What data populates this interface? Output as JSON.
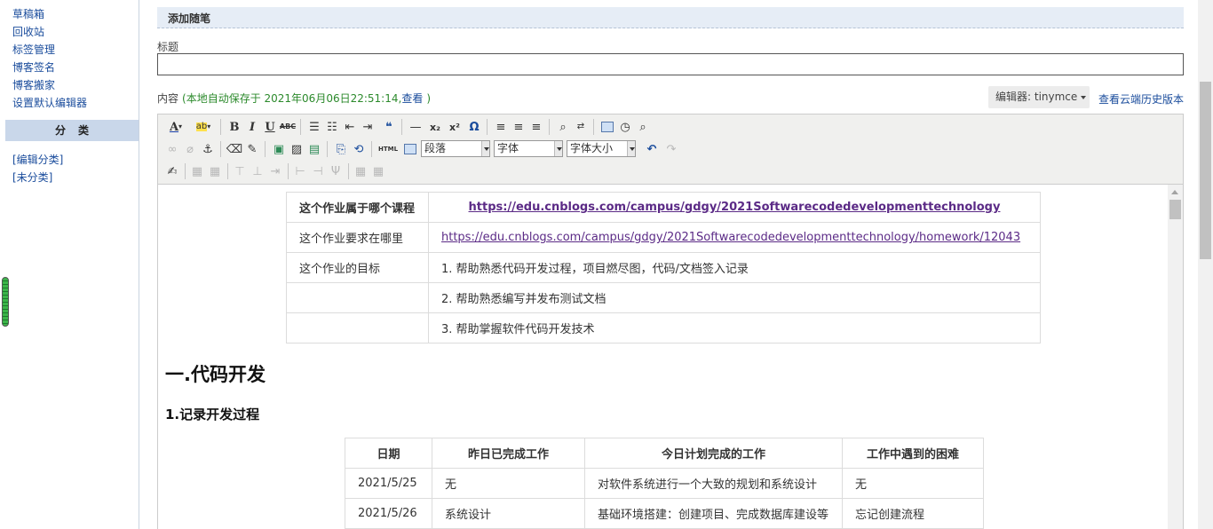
{
  "sidebar": {
    "links": [
      "草稿箱",
      "回收站",
      "标签管理",
      "博客签名",
      "博客搬家",
      "设置默认编辑器"
    ],
    "category_header": "分类",
    "category_links": [
      "[编辑分类]",
      "[未分类]"
    ]
  },
  "section": {
    "title": "添加随笔"
  },
  "title_field": {
    "label": "标题",
    "value": ""
  },
  "content": {
    "label": "内容",
    "autosave_text": "(本地自动保存于 2021年06月06日22:51:14,",
    "view_link": "查看",
    "close_paren": ")"
  },
  "editor_select": {
    "label": "编辑器: tinymce"
  },
  "history_link": "查看云端历史版本",
  "toolbar": {
    "format_select": "段落",
    "font_select": "字体",
    "size_select": "字体大小",
    "html_label": "HTML"
  },
  "info_table": {
    "rows": [
      {
        "key": "这个作业属于哪个课程",
        "value": "https://edu.cnblogs.com/campus/gdgy/2021Softwarecodedevelopmenttechnology"
      },
      {
        "key": "这个作业要求在哪里",
        "value": "https://edu.cnblogs.com/campus/gdgy/2021Softwarecodedevelopmenttechnology/homework/12043"
      },
      {
        "key": "这个作业的目标",
        "value": "1. 帮助熟悉代码开发过程，项目燃尽图，代码/文档签入记录"
      },
      {
        "key": "",
        "value": "2. 帮助熟悉编写并发布测试文档"
      },
      {
        "key": "",
        "value": "3. 帮助掌握软件代码开发技术"
      }
    ]
  },
  "heading1": "一.代码开发",
  "heading2": "1.记录开发过程",
  "log_table": {
    "headers": [
      "日期",
      "昨日已完成工作",
      "今日计划完成的工作",
      "工作中遇到的困难"
    ],
    "rows": [
      [
        "2021/5/25",
        "无",
        "对软件系统进行一个大致的规划和系统设计",
        "无"
      ],
      [
        "2021/5/26",
        "系统设计",
        "基础环境搭建：创建项目、完成数据库建设等",
        "忘记创建流程"
      ]
    ]
  }
}
